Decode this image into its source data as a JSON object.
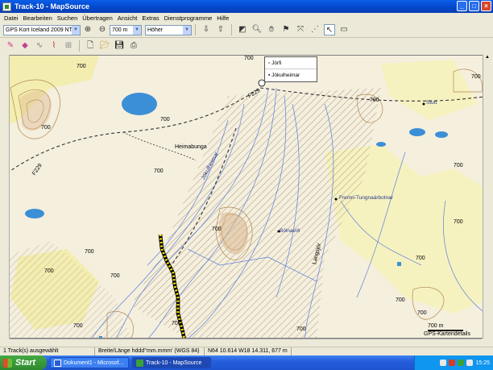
{
  "window": {
    "title": "Track-10 - MapSource"
  },
  "menu": [
    "Datei",
    "Bearbeiten",
    "Suchen",
    "Übertragen",
    "Ansicht",
    "Extras",
    "Dienstprogramme",
    "Hilfe"
  ],
  "toolbar": {
    "product_select": "GPS Kort Iceland 2009 NT",
    "zoom_select": "700 m",
    "detail_select": "Höher"
  },
  "popup": {
    "items": [
      "Jörfi",
      "Jökulheimar"
    ]
  },
  "map_labels": {
    "heimabunga": "Heimabunga",
    "jokulheimar_road": "Jökulheimar",
    "frems_tungnaarbotnar": "Fremri-Tungnaárbotnar",
    "bolnavid": "Bólnavíð",
    "langsjor": "Langsjór",
    "stutt": "Stutt",
    "f229": "F229",
    "f229b": "F229",
    "c700_1": "700",
    "c700_2": "700",
    "c700_3": "700",
    "c700_4": "700",
    "c700_5": "700",
    "c700_6": "700",
    "c700_7": "700",
    "c700_8": "700",
    "c700_9": "700",
    "c700_10": "700",
    "c700_11": "700",
    "c700_12": "700",
    "c700_13": "700",
    "c700_14": "700",
    "c700_15": "700",
    "c700_16": "700",
    "c700_17": "700",
    "c700_18": "700",
    "c700_19": "700",
    "c700_20": "700",
    "scale": "700 m",
    "details": "GPS-Kartendetails"
  },
  "status": {
    "tracks": "1 Track(s) ausgewählt",
    "format": "Breite/Länge hddd°mm.mmm' (WGS 84)",
    "coords": "N64 10.614 W18 14.311, 677 m"
  },
  "taskbar": {
    "start": "Start",
    "tasks": [
      "Dokument1 - Microsof...",
      "Track-10 - MapSource"
    ],
    "clock": "15:25"
  },
  "colors": {
    "water": "#3b8fd6",
    "track": "#ffe600",
    "glacier_hatch": "#b5a68a",
    "land": "#f5efde",
    "yellow_land": "#f5f0a8"
  }
}
